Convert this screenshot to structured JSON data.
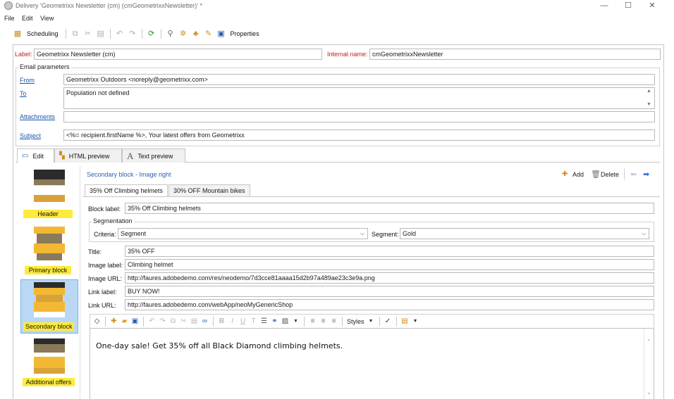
{
  "window": {
    "title": "Delivery 'Geometrixx Newsletter (cm) (cmGeometrixxNewsletter)' *",
    "minimize": "—",
    "maximize": "☐",
    "close": "✕"
  },
  "menu": [
    "File",
    "Edit",
    "View"
  ],
  "toolbar": {
    "scheduling_label": "Scheduling",
    "properties_label": "Properties"
  },
  "header": {
    "label_caption": "Label:",
    "label_value": "Geometrixx Newsletter (cm)",
    "internal_caption": "Internal name:",
    "internal_value": "cmGeometrixxNewsletter"
  },
  "email_params": {
    "group_title": "Email parameters",
    "from_label": "From",
    "from_value": "Geometrixx Outdoors <noreply@geometrixx.com>",
    "to_label": "To",
    "to_value": "Population not defined",
    "attachments_label": "Attachments",
    "attachments_value": "",
    "subject_label": "Subject",
    "subject_value": "<%= recipient.firstName %>, Your latest offers from Geometrixx"
  },
  "tabs": {
    "edit": "Edit",
    "html_preview": "HTML preview",
    "text_preview": "Text preview"
  },
  "blocks": [
    {
      "name": "Header"
    },
    {
      "name": "Primary block"
    },
    {
      "name": "Secondary block"
    },
    {
      "name": "Additional offers"
    }
  ],
  "block_editor": {
    "breadcrumb": "Secondary block  - Image right",
    "add_label": "Add",
    "delete_label": "Delete",
    "subtabs": [
      "35% Off Climbing helmets",
      "30% OFF Mountain bikes"
    ],
    "block_label_caption": "Block label:",
    "block_label_value": "35% Off Climbing helmets",
    "segmentation_title": "Segmentation",
    "criteria_caption": "Criteria:",
    "criteria_value": "Segment",
    "segment_caption": "Segment:",
    "segment_value": "Gold",
    "title_caption": "Title:",
    "title_value": "35% OFF",
    "image_label_caption": "Image label:",
    "image_label_value": "Climbing helmet",
    "image_url_caption": "Image URL:",
    "image_url_value": "http://faures.adobedemo.com/res/neodemo/7d3cce81aaaa15d2b97a489ae23c3e9a.png",
    "link_label_caption": "Link label:",
    "link_label_value": "BUY NOW!",
    "link_url_caption": "Link URL:",
    "link_url_value": "http://faures.adobedemo.com/webApp/neoMyGenericShop",
    "styles_label": "Styles",
    "body_text": "One-day sale! Get 35% off all Black Diamond climbing helmets."
  },
  "colors": {
    "label_red": "#c0201c",
    "link_blue": "#1a56a8",
    "highlight_yellow": "#ffeb3b",
    "selected_blue": "#b9d8f5"
  }
}
